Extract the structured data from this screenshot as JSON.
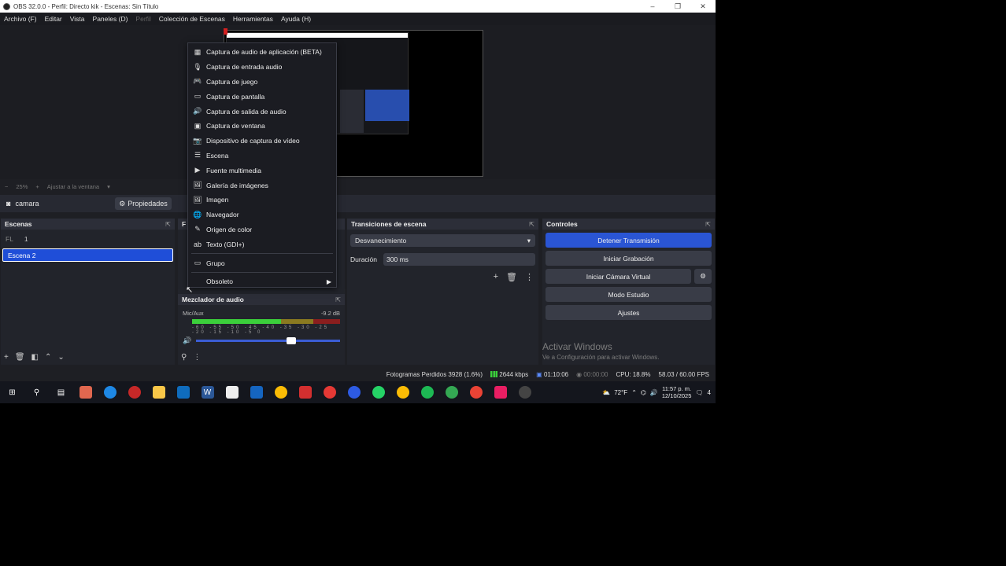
{
  "window": {
    "title": "OBS 32.0.0 - Perfil: Directo kik - Escenas: Sin Título",
    "buttons": [
      "–",
      "❐",
      "✕"
    ]
  },
  "menubar": [
    {
      "label": "Archivo (F)",
      "dim": false
    },
    {
      "label": "Editar",
      "dim": false
    },
    {
      "label": "Vista",
      "dim": false
    },
    {
      "label": "Paneles (D)",
      "dim": false
    },
    {
      "label": "Perfil",
      "dim": true
    },
    {
      "label": "Colección de Escenas",
      "dim": false
    },
    {
      "label": "Herramientas",
      "dim": false
    },
    {
      "label": "Ayuda (H)",
      "dim": false
    }
  ],
  "zoom": {
    "value": "25%",
    "fit": "Ajustar a la ventana"
  },
  "source_toolbar": {
    "source_name": "camara",
    "properties": "Propiedades"
  },
  "scenes": {
    "title": "Escenas",
    "items": [
      {
        "label": "1",
        "selected": false
      },
      {
        "label": "Escena 2",
        "selected": true
      }
    ]
  },
  "sources": {
    "title": "F"
  },
  "context_menu": {
    "items": [
      {
        "icon": "▦",
        "label": "Captura de audio de aplicación (BETA)"
      },
      {
        "icon": "🎙",
        "label": "Captura de entrada audio"
      },
      {
        "icon": "🎮",
        "label": "Captura de juego"
      },
      {
        "icon": "▭",
        "label": "Captura de pantalla"
      },
      {
        "icon": "🔊",
        "label": "Captura de salida de audio"
      },
      {
        "icon": "▣",
        "label": "Captura de ventana"
      },
      {
        "icon": "📷",
        "label": "Dispositivo de captura de vídeo"
      },
      {
        "icon": "☰",
        "label": "Escena"
      },
      {
        "icon": "▶",
        "label": "Fuente multimedia"
      },
      {
        "icon": "🖼",
        "label": "Galería de imágenes"
      },
      {
        "icon": "🖼",
        "label": "Imagen"
      },
      {
        "icon": "🌐",
        "label": "Navegador"
      },
      {
        "icon": "✎",
        "label": "Origen de color"
      },
      {
        "icon": "ab",
        "label": "Texto (GDI+)"
      }
    ],
    "group": "Grupo",
    "obsolete": "Obsoleto"
  },
  "mixer": {
    "title": "Mezclador de audio",
    "channel": "Mic/Aux",
    "db": "-9.2 dB",
    "level": 0.6,
    "ticks": "-60 -55 -50 -45 -40 -35 -30 -25 -20 -15 -10 -5 0"
  },
  "transitions": {
    "title": "Transiciones de escena",
    "selected": "Desvanecimiento",
    "duration_label": "Duración",
    "duration_value": "300 ms"
  },
  "controls": {
    "title": "Controles",
    "stop_stream": "Detener Transmisión",
    "start_record": "Iniciar Grabación",
    "virtual_cam": "Iniciar Cámara Virtual",
    "studio_mode": "Modo Estudio",
    "settings": "Ajustes"
  },
  "watermark": {
    "line1": "Activar Windows",
    "line2": "Ve a Configuración para activar Windows."
  },
  "status": {
    "dropped": "Fotogramas Perdidos 3928 (1.6%)",
    "bitrate": "2644 kbps",
    "live_time": "01:10:06",
    "rec_time": "00:00:00",
    "cpu": "CPU: 18.8%",
    "fps": "58.03 / 60.00 FPS"
  },
  "taskbar": {
    "weather": "72°F",
    "time": "11:57 p. m.",
    "date": "12/10/2025",
    "notifications": "4"
  }
}
